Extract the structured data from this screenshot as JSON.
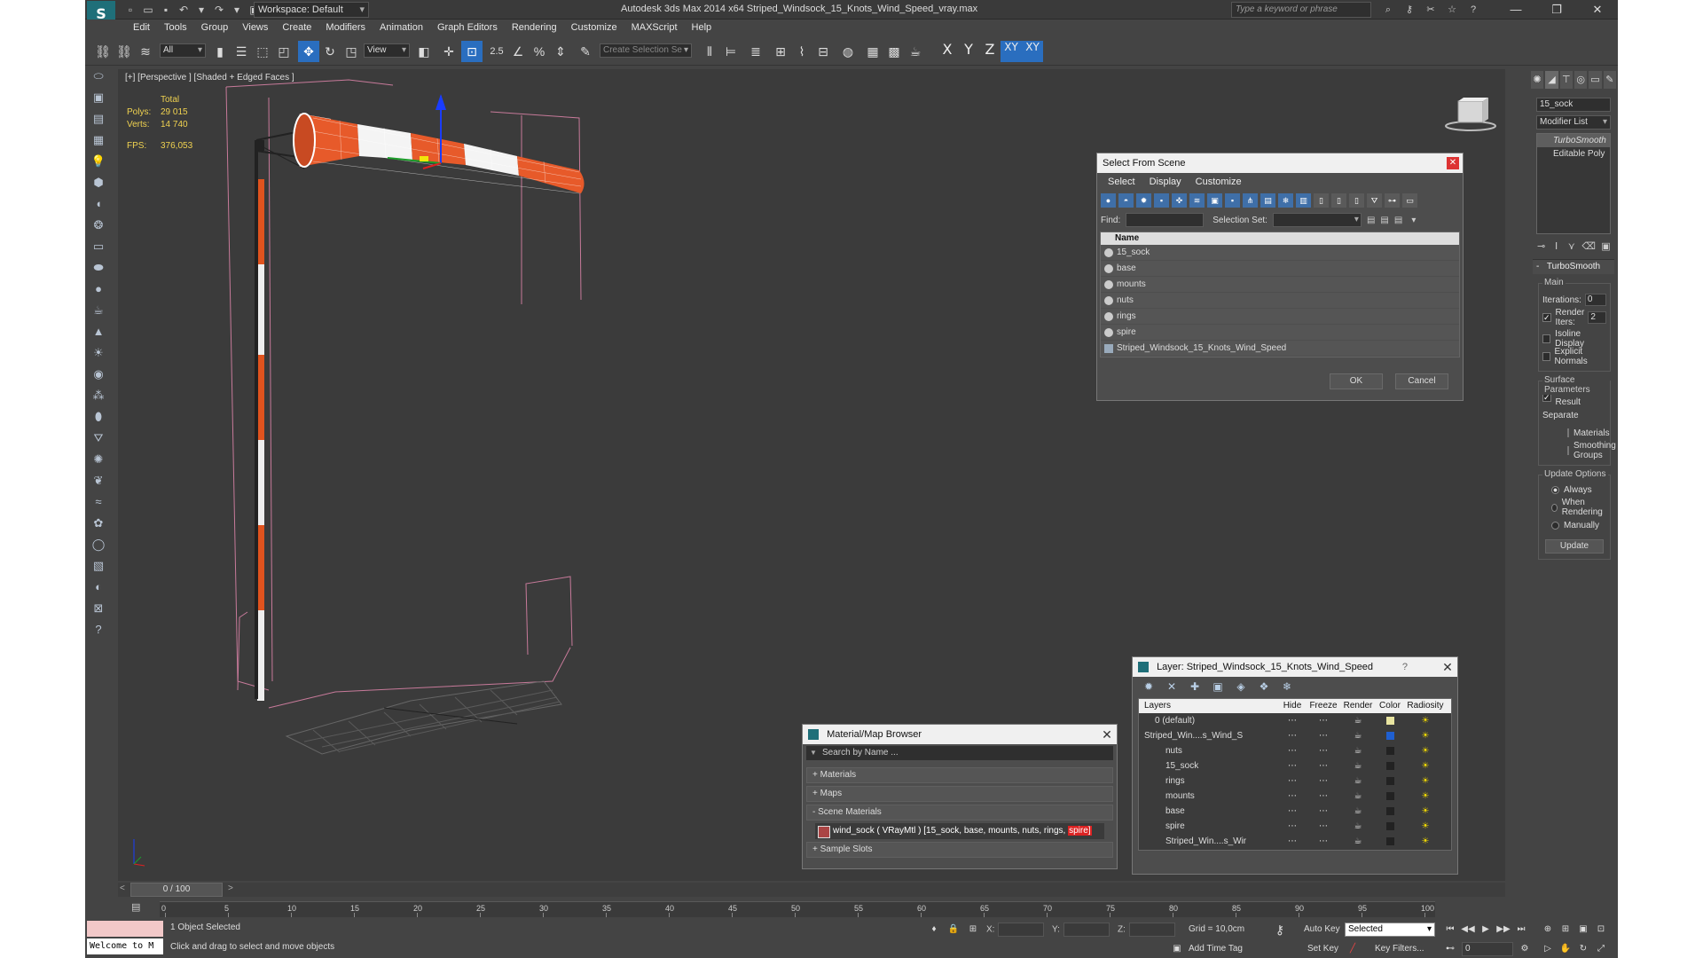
{
  "app": {
    "title": "Autodesk 3ds Max  2014 x64     Striped_Windsock_15_Knots_Wind_Speed_vray.max",
    "workspace": "Workspace: Default",
    "search_placeholder": "Type a keyword or phrase"
  },
  "menu": [
    "Edit",
    "Tools",
    "Group",
    "Views",
    "Create",
    "Modifiers",
    "Animation",
    "Graph Editors",
    "Rendering",
    "Customize",
    "MAXScript",
    "Help"
  ],
  "toolbar": {
    "filter": "All",
    "ref_coord": "View",
    "snap_label": "2.5",
    "sel_set_placeholder": "Create Selection Se",
    "axes": [
      "X",
      "Y",
      "Z",
      "XY",
      "XY"
    ]
  },
  "viewport": {
    "label": "[+] [Perspective ] [Shaded + Edged Faces ]",
    "stats": {
      "total": "Total",
      "polys_k": "Polys:",
      "polys_v": "29 015",
      "verts_k": "Verts:",
      "verts_v": "14 740",
      "fps_k": "FPS:",
      "fps_v": "376,053"
    }
  },
  "select_from_scene": {
    "title": "Select From Scene",
    "menu": [
      "Select",
      "Display",
      "Customize"
    ],
    "find": "Find:",
    "selection_set": "Selection Set:",
    "col_name": "Name",
    "items": [
      "15_sock",
      "base",
      "mounts",
      "nuts",
      "rings",
      "spire",
      "Striped_Windsock_15_Knots_Wind_Speed"
    ],
    "ok": "OK",
    "cancel": "Cancel"
  },
  "material_browser": {
    "title": "Material/Map Browser",
    "search": "Search by Name ...",
    "sections": [
      "+ Materials",
      "+ Maps",
      "- Scene Materials"
    ],
    "material_line": "wind_sock  ( VRayMtl ) [15_sock, base, mounts, nuts, rings, ",
    "material_hl": "spire]",
    "sample_slots": "+ Sample Slots"
  },
  "layer_dialog": {
    "title": "Layer: Striped_Windsock_15_Knots_Wind_Speed",
    "question": "?",
    "columns": [
      "Layers",
      "Hide",
      "Freeze",
      "Render",
      "Color",
      "Radiosity"
    ],
    "rows": [
      {
        "name": "0 (default)",
        "indent": 1,
        "color": "#e8e4a0"
      },
      {
        "name": "Striped_Win....s_Wind_S",
        "indent": 0,
        "color": "#1f5fd0"
      },
      {
        "name": "nuts",
        "indent": 2,
        "color": "#222222"
      },
      {
        "name": "15_sock",
        "indent": 2,
        "color": "#222222"
      },
      {
        "name": "rings",
        "indent": 2,
        "color": "#222222"
      },
      {
        "name": "mounts",
        "indent": 2,
        "color": "#222222"
      },
      {
        "name": "base",
        "indent": 2,
        "color": "#222222"
      },
      {
        "name": "spire",
        "indent": 2,
        "color": "#222222"
      },
      {
        "name": "Striped_Win....s_Wir",
        "indent": 2,
        "color": "#222222"
      }
    ]
  },
  "command_panel": {
    "object_name": "15_sock",
    "modifier_list": "Modifier List",
    "stack": [
      "TurboSmooth",
      "Editable Poly"
    ],
    "rollout": "TurboSmooth",
    "main": "Main",
    "iterations_label": "Iterations:",
    "iterations": "0",
    "render_iters_label": "Render Iters:",
    "render_iters": "2",
    "isoline": "Isoline Display",
    "explicit": "Explicit Normals",
    "surface": "Surface Parameters",
    "smooth_result": "Smooth Result",
    "separate": "Separate",
    "materials": "Materials",
    "smoothing": "Smoothing Groups",
    "update_opts": "Update Options",
    "always": "Always",
    "when_rendering": "When Rendering",
    "manually": "Manually",
    "update": "Update"
  },
  "timeline": {
    "slider": "0 / 100",
    "ticks": [
      "0",
      "5",
      "10",
      "15",
      "20",
      "25",
      "30",
      "35",
      "40",
      "45",
      "50",
      "55",
      "60",
      "65",
      "70",
      "75",
      "80",
      "85",
      "90",
      "95",
      "100"
    ]
  },
  "status": {
    "maxscript": "Welcome to M",
    "selected": "1 Object Selected",
    "hint": "Click and drag to select and move objects",
    "x": "X:",
    "y": "Y:",
    "z": "Z:",
    "grid": "Grid = 10,0cm",
    "add_time_tag": "Add Time Tag",
    "auto_key": "Auto Key",
    "set_key": "Set Key",
    "selected_dd": "Selected",
    "key_filters": "Key Filters...",
    "frame": "0"
  }
}
